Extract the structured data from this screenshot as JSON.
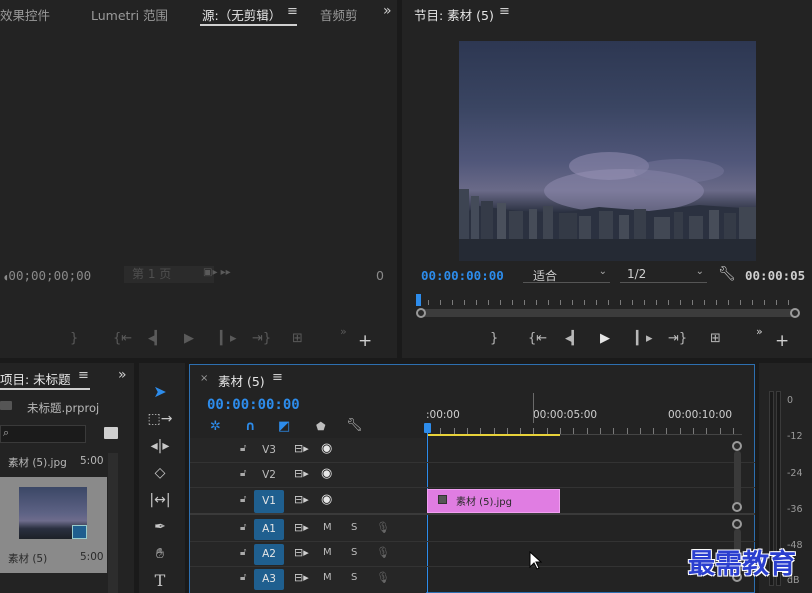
{
  "source_panel": {
    "tabs": [
      "效果控件",
      "Lumetri 范围",
      "源:（无剪辑）",
      "音频剪"
    ],
    "overflow_icon": "»",
    "timecode_left": "00;00;00;00",
    "page_select": "第 1 页",
    "timecode_right": "0"
  },
  "program_panel": {
    "title": "节目: 素材 (5)",
    "timecode_current": "00:00:00:00",
    "fit_select": "适合",
    "resolution_select": "1/2",
    "timecode_duration": "00:00:05"
  },
  "project_panel": {
    "title": "项目: 未标题",
    "project_file": "未标题.prproj",
    "items": [
      {
        "name": "素材 (5).jpg",
        "duration": "5:00"
      },
      {
        "name": "素材 (5)",
        "duration": "5:00"
      }
    ]
  },
  "timeline": {
    "sequence_tab": "素材 (5)",
    "timecode": "00:00:00:00",
    "ruler_labels": [
      ":00:00",
      "00:00:05:00",
      "00:00:10:00"
    ],
    "video_tracks": [
      "V3",
      "V2",
      "V1"
    ],
    "audio_tracks": [
      "A1",
      "A2",
      "A3"
    ],
    "clip_name": "素材 (5).jpg",
    "m_label": "M",
    "s_label": "S",
    "colors": {
      "clip": "#e07de2",
      "accent": "#2d8ceb",
      "track_target": "#1f5f8f"
    }
  },
  "audio_meter": {
    "ticks": [
      "0",
      "-12",
      "-24",
      "-36",
      "-48",
      "dB"
    ]
  },
  "watermark": "最需教育"
}
